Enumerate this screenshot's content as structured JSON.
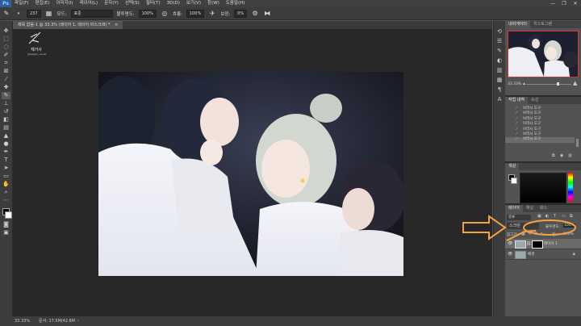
{
  "app": {
    "logo": "Ps",
    "menu": [
      "파일(F)",
      "편집(E)",
      "이미지(I)",
      "레이어(L)",
      "문자(Y)",
      "선택(S)",
      "필터(T)",
      "3D(D)",
      "보기(V)",
      "창(W)",
      "도움말(H)"
    ],
    "window_controls": [
      "—",
      "❐",
      "✕"
    ]
  },
  "options": {
    "size": "237",
    "mode_label": "모드:",
    "mode_value": "표준",
    "opacity_label": "불투명도:",
    "opacity_value": "100%",
    "flow_label": "흐름:",
    "flow_value": "100%",
    "smooth_label": "보정:",
    "smooth_value": "0%"
  },
  "document": {
    "tab_title": "제목 없음-1 @ 33.3% (레이어 1, 레이어 마스크/8) *",
    "watermark_line1": "재거사",
    "watermark_line2": "@jaegeo_visual"
  },
  "status": {
    "zoom": "33.33%",
    "doc": "문서: 17.5M/42.8M"
  },
  "navigator": {
    "tabs": [
      "내비게이터",
      "히스토그램"
    ],
    "zoom": "33.33%"
  },
  "history": {
    "tabs": [
      "작업 내역",
      "속성"
    ],
    "items": [
      "브러시 도구",
      "브러시 도구",
      "브러시 도구",
      "브러시 도구",
      "브러시 도구",
      "브러시 도구",
      "브러시 도구"
    ]
  },
  "color": {
    "tabs": [
      "색상"
    ]
  },
  "layers": {
    "tabs": [
      "레이어",
      "채널",
      "패스"
    ],
    "kind_label": "종류",
    "blend_mode": "스크린",
    "opacity_label": "불투명도:",
    "opacity_value": "100%",
    "lock_label": "잠그기:",
    "fill_label": "칠:",
    "fill_value": "100%",
    "items": [
      {
        "name": "레이어 1"
      },
      {
        "name": "배경"
      }
    ]
  },
  "colors": {
    "accent": "#f5a042",
    "panel": "#535353",
    "dark": "#3c3c3c",
    "workspace": "#282828"
  }
}
